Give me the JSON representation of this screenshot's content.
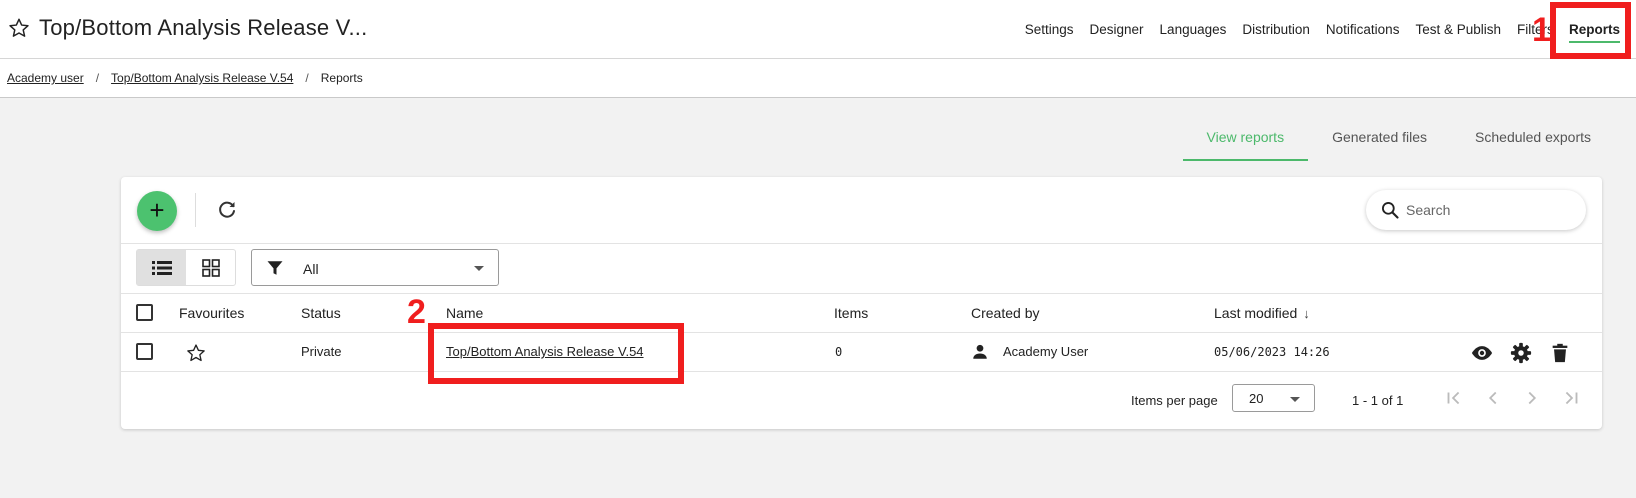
{
  "header": {
    "title": "Top/Bottom Analysis Release V...",
    "nav": [
      {
        "label": "Settings"
      },
      {
        "label": "Designer"
      },
      {
        "label": "Languages"
      },
      {
        "label": "Distribution"
      },
      {
        "label": "Notifications"
      },
      {
        "label": "Test & Publish"
      },
      {
        "label": "Filters"
      },
      {
        "label": "Reports"
      }
    ],
    "active_nav": "Reports"
  },
  "breadcrumb": [
    "Academy user",
    "Top/Bottom Analysis Release V.54",
    "Reports"
  ],
  "tabs": [
    {
      "label": "View reports",
      "active": true
    },
    {
      "label": "Generated files",
      "active": false
    },
    {
      "label": "Scheduled exports",
      "active": false
    }
  ],
  "toolbar": {
    "add_icon": "plus-icon",
    "refresh_icon": "refresh-icon",
    "search_placeholder": "Search",
    "filter_value": "All"
  },
  "table": {
    "columns": [
      "Favourites",
      "Status",
      "Name",
      "Items",
      "Created by",
      "Last modified"
    ],
    "sort_column": "Last modified",
    "sort_direction": "descending",
    "rows": [
      {
        "favourite": false,
        "status": "Private",
        "name": "Top/Bottom Analysis Release V.54",
        "items": "0",
        "created_by": "Academy User",
        "last_modified": "05/06/2023 14:26"
      }
    ],
    "row_actions": [
      "eye-icon",
      "gear-icon",
      "trash-icon"
    ]
  },
  "pagination": {
    "items_per_page_label": "Items per page",
    "items_per_page": "20",
    "range": "1 - 1 of 1"
  },
  "annotations": [
    {
      "number": "1",
      "color": "#f01e1e"
    },
    {
      "number": "2",
      "color": "#f01e1e"
    }
  ],
  "colors": {
    "accent": "#4cb96b",
    "fab": "#4cc26f",
    "annotation": "#f01e1e"
  }
}
